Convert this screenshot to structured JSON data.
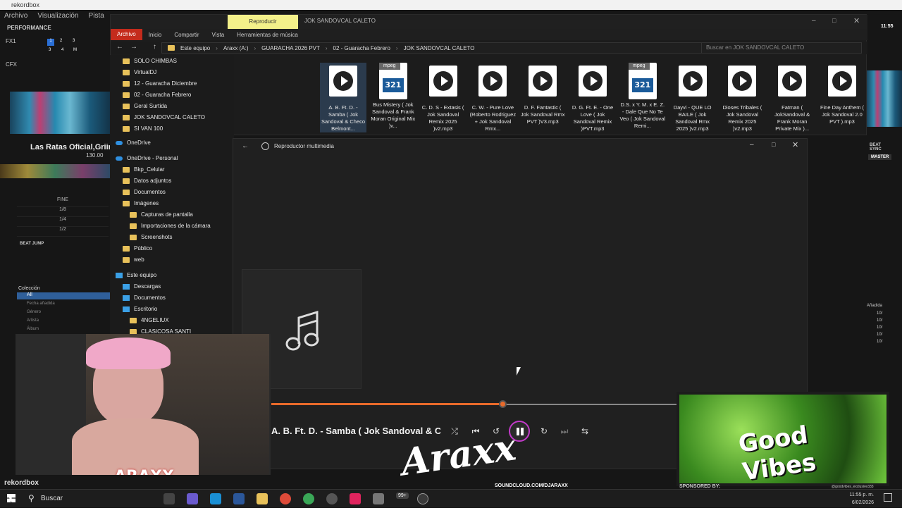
{
  "rekordbox": {
    "title": "rekordbox",
    "menu": [
      "Archivo",
      "Visualización",
      "Pista"
    ],
    "mode": "PERFORMANCE",
    "fx": "FX1",
    "cfx": "CFX",
    "fx_nums": [
      "1",
      "2",
      "3",
      "3",
      "4",
      "M"
    ],
    "deck_track": "Las Ratas Oficial,Griin",
    "deck_bpm": "130.00",
    "clock": "11:55",
    "beat_rows": [
      "FINE",
      "1/8",
      "1/4",
      "1/2"
    ],
    "beat_jump": "BEAT JUMP",
    "beat_sync": "BEAT SYNC",
    "master": "MASTER",
    "browser": {
      "collection": "Colección",
      "items": [
        "All",
        "Fecha añadida",
        "Género",
        "Artista",
        "Álbum"
      ]
    },
    "logo": "rekordbox",
    "right_label": "Añadida",
    "right_vals": [
      "10/",
      "10/",
      "10/",
      "10/",
      "10/"
    ]
  },
  "explorer": {
    "tab_active": "Reproducir",
    "window_title": "JOK SANDOVCAL CALETO",
    "ribbon": [
      "Archivo",
      "Inicio",
      "Compartir",
      "Vista",
      "Herramientas de música"
    ],
    "breadcrumb": [
      "Este equipo",
      "Araxx (A:)",
      "GUARACHA 2026 PVT",
      "02 - Guaracha Febrero",
      "JOK SANDOVCAL CALETO"
    ],
    "search_placeholder": "Buscar en JOK SANDOVCAL CALETO",
    "nav": [
      {
        "label": "SOLO CHIMBAS",
        "type": "folder",
        "indent": 0
      },
      {
        "label": "VirtualDJ",
        "type": "folder",
        "indent": 0
      },
      {
        "label": "12 -  Guaracha Diciembre",
        "type": "folder",
        "indent": 0
      },
      {
        "label": "02 - Guaracha Febrero",
        "type": "folder",
        "indent": 0
      },
      {
        "label": "Geral Surtida",
        "type": "folder",
        "indent": 0
      },
      {
        "label": "JOK SANDOVCAL CALETO",
        "type": "folder",
        "indent": 0
      },
      {
        "label": "SI VAN 100",
        "type": "folder",
        "indent": 0
      },
      {
        "label": "OneDrive",
        "type": "cloud",
        "indent": -1
      },
      {
        "label": "OneDrive - Personal",
        "type": "cloud",
        "indent": -1
      },
      {
        "label": "Bkp_Celular",
        "type": "folder",
        "indent": 0
      },
      {
        "label": "Datos adjuntos",
        "type": "folder",
        "indent": 0
      },
      {
        "label": "Documentos",
        "type": "folder",
        "indent": 0
      },
      {
        "label": "Imágenes",
        "type": "folder",
        "indent": 0
      },
      {
        "label": "Capturas de pantalla",
        "type": "folder",
        "indent": 1
      },
      {
        "label": "Importaciones de la cámara",
        "type": "folder",
        "indent": 1
      },
      {
        "label": "Screenshots",
        "type": "folder",
        "indent": 1
      },
      {
        "label": "Público",
        "type": "folder",
        "indent": 0
      },
      {
        "label": "web",
        "type": "folder",
        "indent": 0
      },
      {
        "label": "Este equipo",
        "type": "pc",
        "indent": -1
      },
      {
        "label": "Descargas",
        "type": "pc",
        "indent": 0
      },
      {
        "label": "Documentos",
        "type": "pc",
        "indent": 0
      },
      {
        "label": "Escritorio",
        "type": "pc",
        "indent": 0
      },
      {
        "label": "4NGELIUX",
        "type": "folder",
        "indent": 1
      },
      {
        "label": "CLASICOSA SANTI",
        "type": "folder",
        "indent": 1
      }
    ],
    "files": [
      {
        "name": "A. B. Ft. D. - Samba ( Jok Sandoval & Checo Belmont...",
        "icon": "play"
      },
      {
        "name": "Bus Mistery ( Jok Sandoval & Frank Moran Original Mix )v...",
        "icon": "mpc"
      },
      {
        "name": "C. D. S - Extasis ( Jok Sandoval Remix 2025 )v2.mp3",
        "icon": "play"
      },
      {
        "name": "C. W. -  Pure Love (Roberto Rodriguez + Jok Sandoval Rmx...",
        "icon": "play"
      },
      {
        "name": "D. F. Fantastic ( Jok Sandoval Rmx PVT )V3.mp3",
        "icon": "play"
      },
      {
        "name": "D. G. Ft. E. - One Love ( Jok Sandoval Remix )PVT.mp3",
        "icon": "play"
      },
      {
        "name": "D.S. x Y. M. x E. Z. - Dale Que No Te Veo ( Jok Sandoval Remi...",
        "icon": "mpc"
      },
      {
        "name": "Dayvi - QUE LO BAILE ( Jok Sandoval Rmx 2025 )v2.mp3",
        "icon": "play"
      },
      {
        "name": "Dioses Tribales ( Jok Sandoval Remix 2025 )v2.mp3",
        "icon": "play"
      },
      {
        "name": "Fatman ( JokSandoval & Frank Moran Private Mix )...",
        "icon": "play"
      },
      {
        "name": "Fine Day Anthem ( Jok Sandoval 2.0 PVT ).mp3",
        "icon": "play"
      }
    ],
    "mpeg_tag": "mpeg",
    "mpc_number": "321"
  },
  "player": {
    "title": "Reproductor multimedia",
    "now_playing": "A. B. Ft. D. - Samba ( Jok Sandoval & Checo...",
    "progress": 0.57,
    "accent": "#e96a2a"
  },
  "overlay": {
    "sign": "Araxx",
    "soundcloud": "SOUNDCLOUD.COM/DJARAXX",
    "sponsored": "SPONSORED BY:",
    "handle": "@goodvibes_exclusive333",
    "gv_text": "Good Vibes",
    "cam_name": "ARAXX"
  },
  "taskbar": {
    "search": "Buscar",
    "time": "11:55 p. m.",
    "date": "6/02/2026",
    "badge": "99+"
  }
}
